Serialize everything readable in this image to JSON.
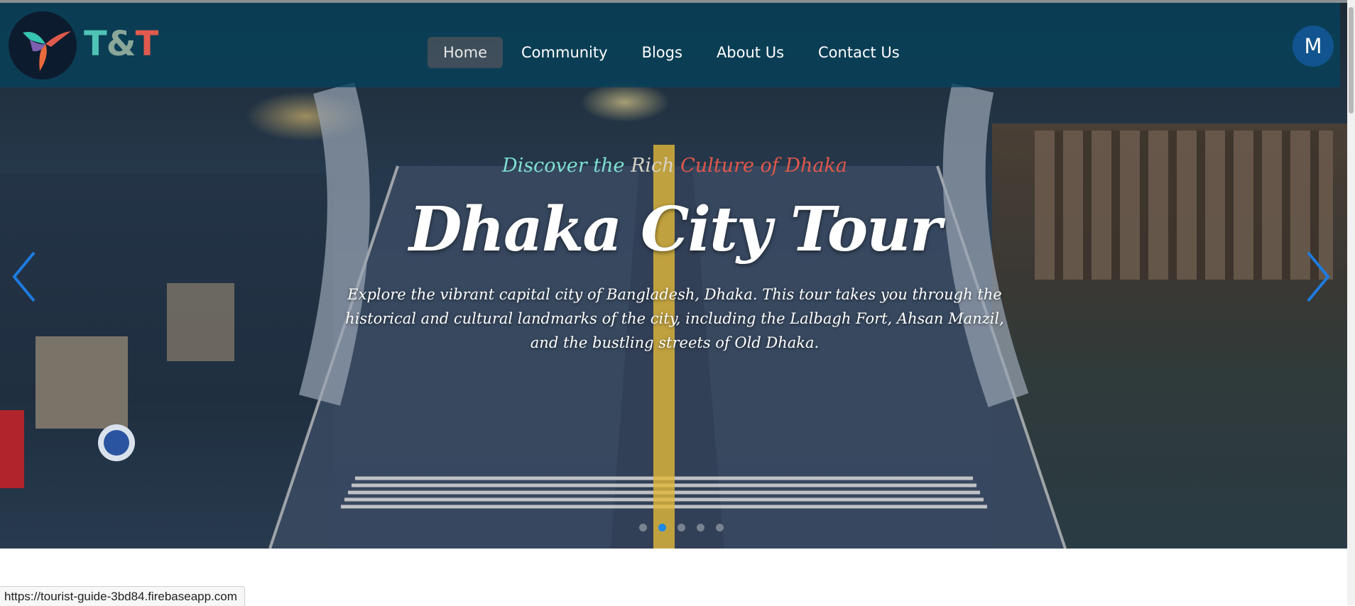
{
  "brand": {
    "part1": "T",
    "amp": "&",
    "part2": "T"
  },
  "nav": {
    "items": [
      {
        "label": "Home",
        "active": true
      },
      {
        "label": "Community"
      },
      {
        "label": "Blogs"
      },
      {
        "label": "About Us"
      },
      {
        "label": "Contact Us"
      }
    ]
  },
  "user": {
    "avatar_initial": "M"
  },
  "hero": {
    "tagline": {
      "part1": "Discover the ",
      "part2": "Rich ",
      "part3": "Culture of Dhaka"
    },
    "title": "Dhaka City Tour",
    "description": "Explore the vibrant capital city of Bangladesh, Dhaka. This tour takes you through the historical and cultural landmarks of the city, including the Lalbagh Fort, Ahsan Manzil, and the bustling streets of Old Dhaka.",
    "slides_total": 5,
    "active_slide": 2
  },
  "status_bar": {
    "url": "https://tourist-guide-3bd84.firebaseapp.com"
  },
  "colors": {
    "accent": "#1e88e5",
    "header_bg": "#05425c",
    "brand_teal": "#4fc3b5",
    "brand_red": "#e05a4d"
  }
}
